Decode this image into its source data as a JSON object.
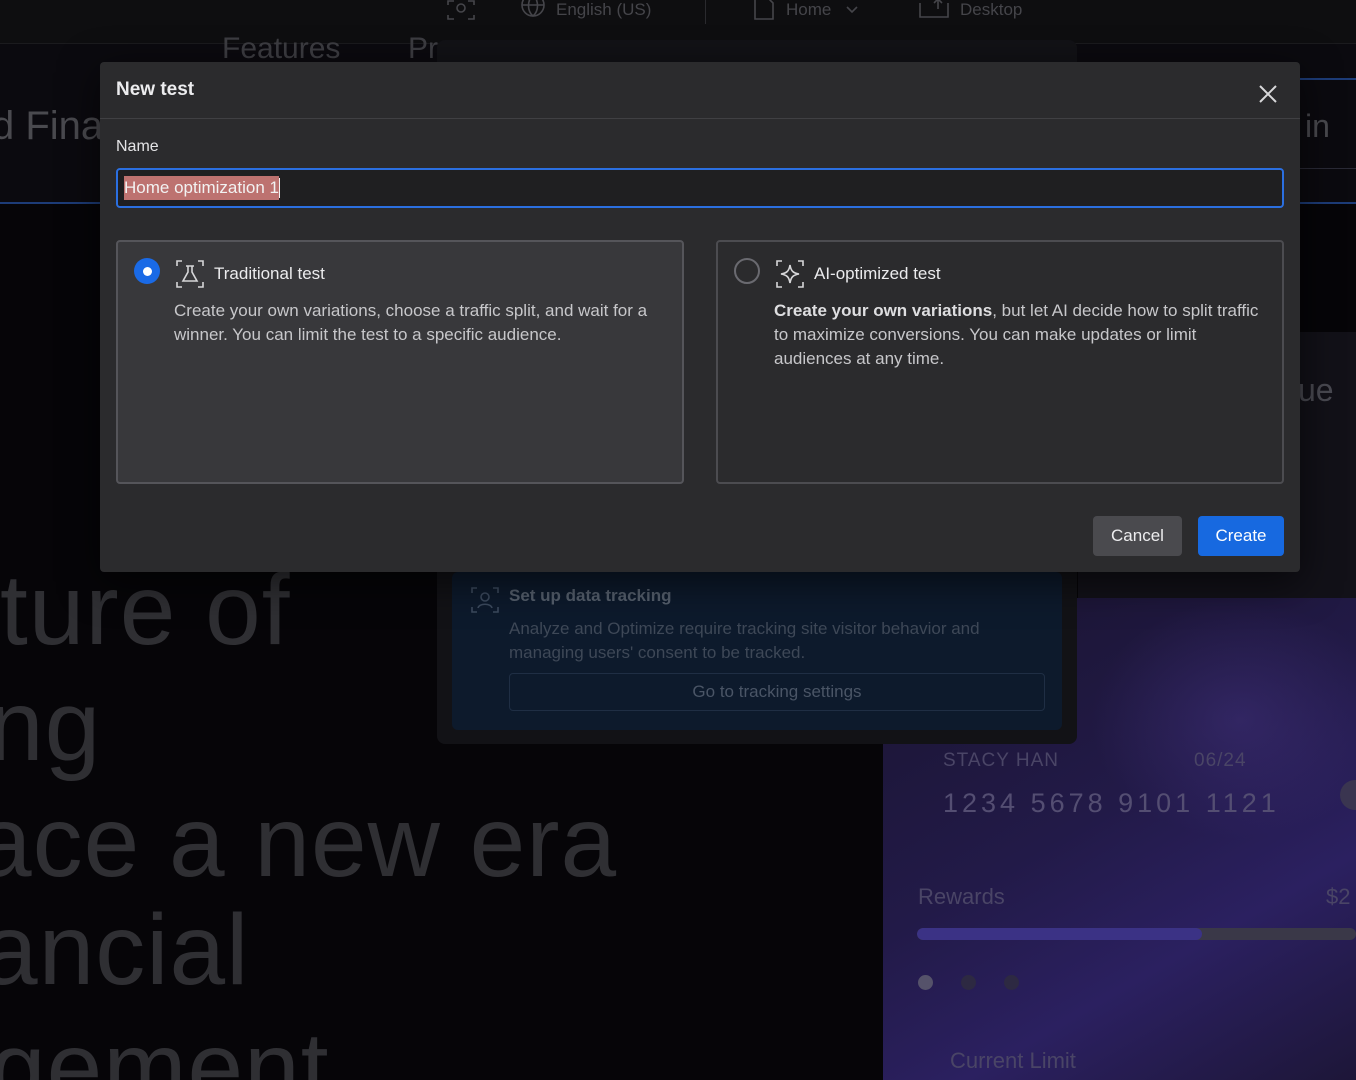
{
  "background": {
    "topbar": {
      "language": "English (US)",
      "page": "Home",
      "device": "Desktop"
    },
    "nav": [
      "Features",
      "Pr"
    ],
    "band_left_fragment": "d Fina",
    "band_right_fragment": "in",
    "hero_lines": [
      "ture of",
      "ng",
      "ace a new era",
      "ancial",
      "gement"
    ],
    "right_panel_fragment": "ue",
    "tracking": {
      "title": "Set up data tracking",
      "description": "Analyze and Optimize require tracking site visitor behavior and managing users' consent to be tracked.",
      "button": "Go to tracking settings"
    },
    "card": {
      "holder": "STACY HAN",
      "expiry": "06/24",
      "number": "1234 5678 9101 1121",
      "rewards_label": "Rewards",
      "rewards_amount": "$2",
      "rewards_progress": 0.65,
      "limit_label": "Current Limit"
    }
  },
  "modal": {
    "title": "New test",
    "name_label": "Name",
    "name_value": "Home optimization 1",
    "options": [
      {
        "title": "Traditional test",
        "description": "Create your own variations, choose a traffic split, and wait for a winner. You can limit the test to a specific audience.",
        "selected": true
      },
      {
        "title": "AI-optimized test",
        "description_bold": "Create your own variations",
        "description_rest": ", but let AI decide how to split traffic to maximize conversions. You can make updates or limit audiences at any time.",
        "selected": false
      }
    ],
    "cancel_label": "Cancel",
    "create_label": "Create"
  },
  "colors": {
    "accent": "#1769e0",
    "selection": "#bd7270",
    "modal_bg": "#2b2b2d"
  }
}
